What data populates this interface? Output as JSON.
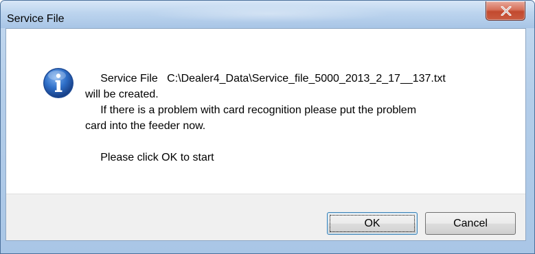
{
  "window": {
    "title": "Service File",
    "close_symbol": "X"
  },
  "message": {
    "icon": "information-icon",
    "line1": "     Service File   C:\\Dealer4_Data\\Service_file_5000_2013_2_17__137.txt",
    "line2": "will be created.",
    "line3": "     If there is a problem with card recognition please put the problem",
    "line4": "card into the feeder now.",
    "line5": "     Please click OK to start"
  },
  "buttons": {
    "ok_label": "OK",
    "cancel_label": "Cancel"
  },
  "colors": {
    "titlebar": "#b3cde9",
    "close_button": "#c24a2f",
    "info_icon": "#2a63b8",
    "footer": "#f0f0f0"
  }
}
